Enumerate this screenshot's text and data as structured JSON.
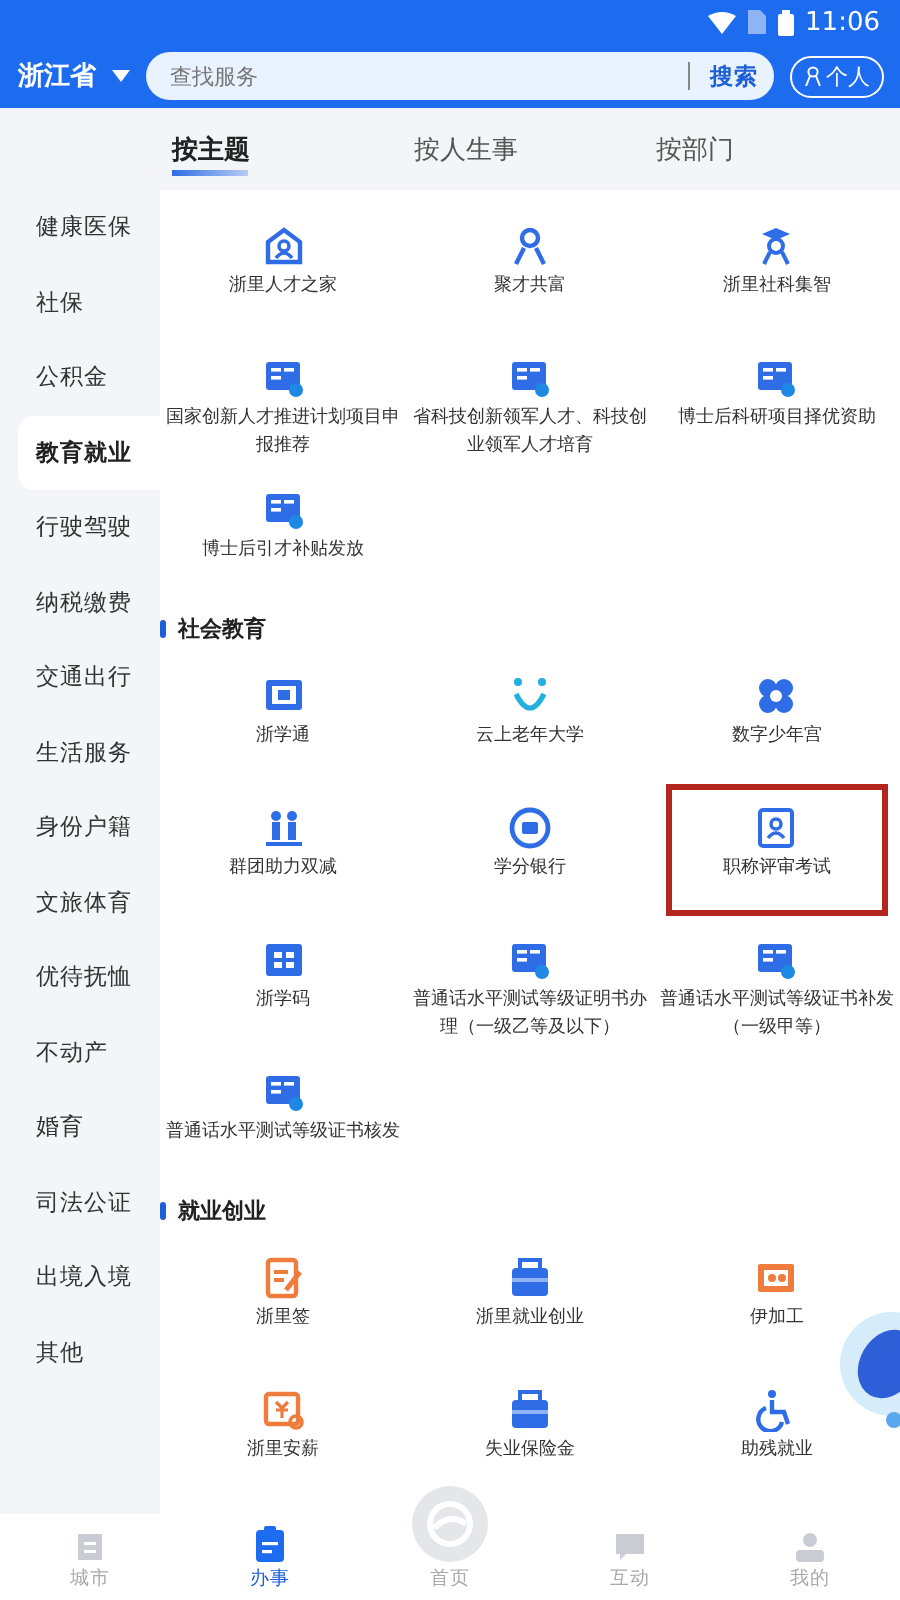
{
  "status_bar": {
    "time": "11:06"
  },
  "header": {
    "region": "浙江省",
    "search": {
      "placeholder": "查找服务",
      "button": "搜索"
    },
    "personal": "个人"
  },
  "tabs": [
    {
      "label": "按主题",
      "selected": true
    },
    {
      "label": "按人生事",
      "selected": false
    },
    {
      "label": "按部门",
      "selected": false
    }
  ],
  "sidebar": {
    "items": [
      {
        "label": "健康医保",
        "selected": false
      },
      {
        "label": "社保",
        "selected": false
      },
      {
        "label": "公积金",
        "selected": false
      },
      {
        "label": "教育就业",
        "selected": true
      },
      {
        "label": "行驶驾驶",
        "selected": false
      },
      {
        "label": "纳税缴费",
        "selected": false
      },
      {
        "label": "交通出行",
        "selected": false
      },
      {
        "label": "生活服务",
        "selected": false
      },
      {
        "label": "身份户籍",
        "selected": false
      },
      {
        "label": "文旅体育",
        "selected": false
      },
      {
        "label": "优待抚恤",
        "selected": false
      },
      {
        "label": "不动产",
        "selected": false
      },
      {
        "label": "婚育",
        "selected": false
      },
      {
        "label": "司法公证",
        "selected": false
      },
      {
        "label": "出境入境",
        "selected": false
      },
      {
        "label": "其他",
        "selected": false
      }
    ]
  },
  "sections": [
    {
      "items": [
        {
          "label": "浙里人才之家",
          "highlighted": false
        },
        {
          "label": "聚才共富",
          "highlighted": false
        },
        {
          "label": "浙里社科集智",
          "highlighted": false
        },
        {
          "label": "国家创新人才推进计划项目申报推荐",
          "highlighted": false
        },
        {
          "label": "省科技创新领军人才、科技创业领军人才培育",
          "highlighted": false
        },
        {
          "label": "博士后科研项目择优资助",
          "highlighted": false
        },
        {
          "label": "博士后引才补贴发放",
          "highlighted": false
        }
      ]
    },
    {
      "title": "社会教育",
      "items": [
        {
          "label": "浙学通",
          "highlighted": false
        },
        {
          "label": "云上老年大学",
          "highlighted": false
        },
        {
          "label": "数字少年宫",
          "highlighted": false
        },
        {
          "label": "群团助力双减",
          "highlighted": false
        },
        {
          "label": "学分银行",
          "highlighted": false
        },
        {
          "label": "职称评审考试",
          "highlighted": true
        },
        {
          "label": "浙学码",
          "highlighted": false
        },
        {
          "label": "普通话水平测试等级证明书办理（一级乙等及以下）",
          "highlighted": false
        },
        {
          "label": "普通话水平测试等级证书补发（一级甲等）",
          "highlighted": false
        },
        {
          "label": "普通话水平测试等级证书核发",
          "highlighted": false
        }
      ]
    },
    {
      "title": "就业创业",
      "items": [
        {
          "label": "浙里签",
          "highlighted": false
        },
        {
          "label": "浙里就业创业",
          "highlighted": false
        },
        {
          "label": "伊加工",
          "highlighted": false
        },
        {
          "label": "浙里安薪",
          "highlighted": false
        },
        {
          "label": "失业保险金",
          "highlighted": false
        },
        {
          "label": "助残就业",
          "highlighted": false
        }
      ]
    }
  ],
  "bottom_nav": [
    {
      "label": "城市",
      "selected": false
    },
    {
      "label": "办事",
      "selected": true
    },
    {
      "label": "首页",
      "selected": false
    },
    {
      "label": "互动",
      "selected": false
    },
    {
      "label": "我的",
      "selected": false
    }
  ]
}
